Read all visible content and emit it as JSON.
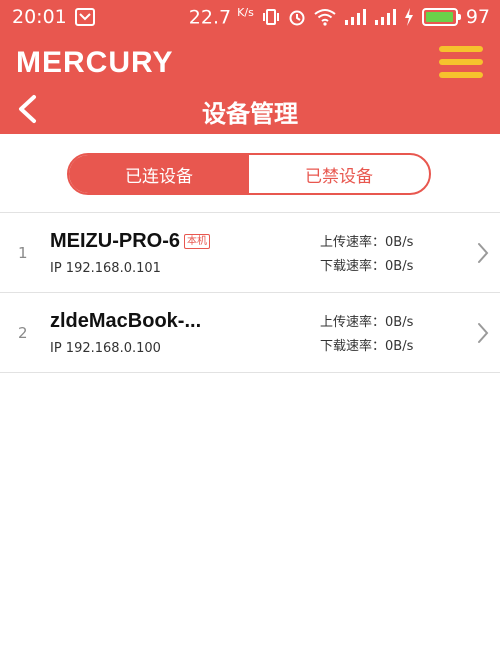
{
  "status_bar": {
    "time": "20:01",
    "network_speed": "22.7",
    "network_unit": "K/s",
    "battery": "97",
    "battery_level": 0.97
  },
  "header": {
    "brand": "MERCURY",
    "title": "设备管理"
  },
  "tabs": {
    "connected_label": "已连设备",
    "blocked_label": "已禁设备",
    "active": "connected"
  },
  "devices": [
    {
      "index": "1",
      "name": "MEIZU-PRO-6",
      "tag": "本机",
      "ip": "IP 192.168.0.101",
      "upload": "上传速率：0B/s",
      "download": "下载速率：0B/s"
    },
    {
      "index": "2",
      "name": "zldeMacBook-...",
      "tag": "",
      "ip": "IP 192.168.0.100",
      "upload": "上传速率：0B/s",
      "download": "下载速率：0B/s"
    }
  ],
  "colors": {
    "accent": "#e8574f",
    "menu_icon": "#f6c22d",
    "battery_fill": "#6ad14a"
  }
}
